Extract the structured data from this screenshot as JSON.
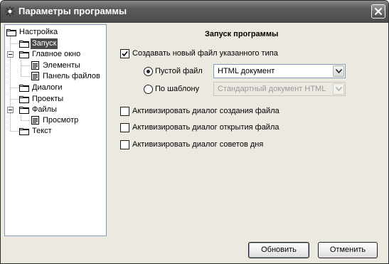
{
  "window": {
    "title": "Параметры программы"
  },
  "tree": {
    "items": [
      {
        "label": "Настройка"
      },
      {
        "label": "Запуск"
      },
      {
        "label": "Главное окно"
      },
      {
        "label": "Элементы"
      },
      {
        "label": "Панель файлов"
      },
      {
        "label": "Диалоги"
      },
      {
        "label": "Проекты"
      },
      {
        "label": "Файлы"
      },
      {
        "label": "Просмотр"
      },
      {
        "label": "Текст"
      }
    ],
    "selected": "Запуск"
  },
  "panel": {
    "title": "Запуск программы",
    "create_new_file": {
      "label": "Создавать новый файл указанного типа",
      "checked": true
    },
    "empty_file": {
      "label": "Пустой файл",
      "selected": true,
      "value": "HTML документ"
    },
    "by_template": {
      "label": "По шаблону",
      "selected": false,
      "value": "Стандартный документ HTML"
    },
    "dialog_create": {
      "label": "Активизировать диалог создания файла",
      "checked": false
    },
    "dialog_open": {
      "label": "Активизировать диалог открытия файла",
      "checked": false
    },
    "dialog_tips": {
      "label": "Активизировать диалог советов дня",
      "checked": false
    }
  },
  "buttons": {
    "ok": "Обновить",
    "cancel": "Отменить"
  },
  "colors": {
    "titlebar": "#5c5c5c",
    "window_bg": "#ece9e1",
    "selection": "#4a4a4a"
  },
  "icons": {
    "app": "gear-sparkle-icon",
    "close": "close-icon",
    "folder": "folder-icon",
    "document": "document-icon",
    "dropdown": "chevron-down-icon"
  }
}
